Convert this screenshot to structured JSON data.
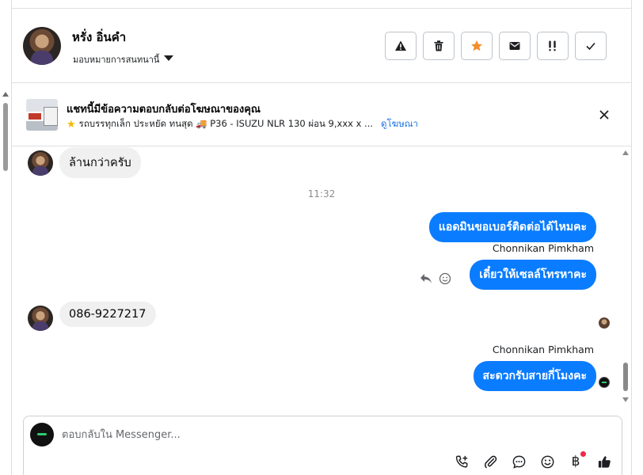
{
  "header": {
    "contact_name": "หรั่ง อิ่นคำ",
    "assign_label": "มอบหมายการสนทนานี้",
    "actions": [
      "warning-icon",
      "trash-icon",
      "star-icon",
      "envelope-icon",
      "important-icon",
      "check-icon"
    ],
    "star_color": "#f58d2b"
  },
  "ad_banner": {
    "title": "แชทนี้มีข้อความตอบกลับต่อโฆษณาของคุณ",
    "ad_text": "รถบรรทุกเล็ก ประหยัด ทนสุด 🚚 P36 - ISUZU NLR 130 ผ่อน 9,xxx x ...",
    "view_ad_label": "ดูโฆษณา"
  },
  "conversation": {
    "messages": [
      {
        "direction": "in",
        "text": "ล้านกว่าครับ"
      },
      {
        "type": "timestamp",
        "text": "11:32"
      },
      {
        "direction": "out",
        "text": "แอดมินขอเบอร์ติดต่อได้ไหมคะ"
      },
      {
        "direction": "out",
        "sender": "Chonnikan Pimkham",
        "text": "เดี๋ยวให้เซลล์โทรหาคะ"
      },
      {
        "direction": "in",
        "text": "086-9227217"
      },
      {
        "direction": "out",
        "sender": "Chonnikan Pimkham",
        "text": "สะดวกรับสายกี่โมงคะ"
      }
    ]
  },
  "composer": {
    "placeholder": "ตอบกลับใน Messenger...",
    "tools": [
      "call-add-icon",
      "attachment-icon",
      "chat-bubble-icon",
      "emoji-icon",
      "baht-icon",
      "thumbs-up-icon"
    ],
    "accent": "#0a7cff"
  }
}
